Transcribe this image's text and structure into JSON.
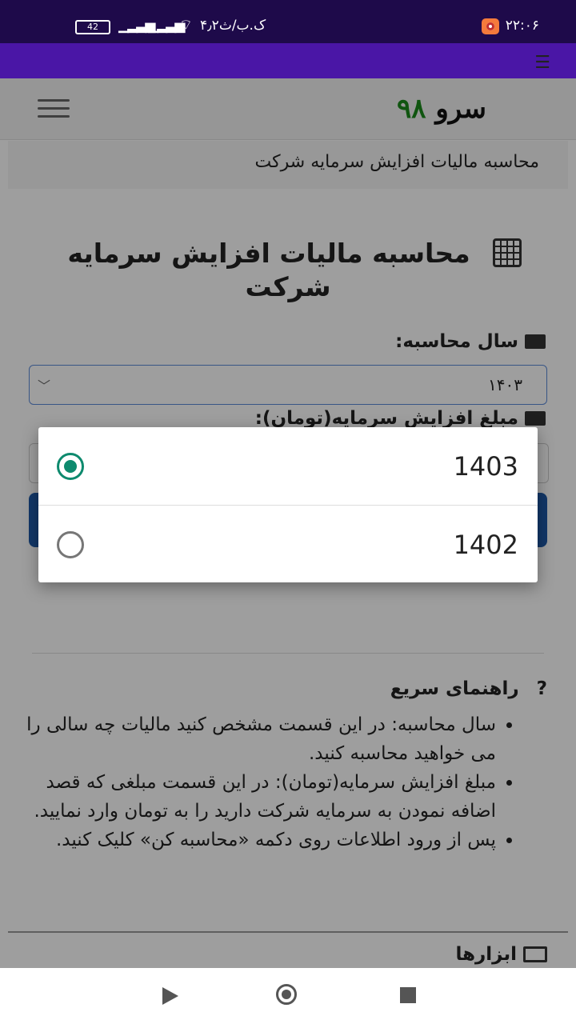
{
  "status_bar": {
    "time": "۲۲:۰۶",
    "network_speed": "۴٫۲ک.ب/ث",
    "battery": "42"
  },
  "header": {
    "logo_word": "سرو",
    "logo_number": "۹۸"
  },
  "breadcrumb": {
    "current": "محاسبه مالیات افزایش سرمایه شرکت"
  },
  "main": {
    "title": "محاسبه مالیات افزایش سرمایه شرکت",
    "year_label": "سال محاسبه:",
    "year_selected": "۱۴۰۳",
    "amount_label": "مبلغ افزایش سرمایه(تومان):"
  },
  "guide": {
    "title": "راهنمای سریع",
    "items": [
      "سال محاسبه: در این قسمت مشخص کنید مالیات چه سالی را می خواهید محاسبه کنید.",
      "مبلغ افزایش سرمایه(تومان): در این قسمت مبلغی که قصد اضافه نمودن به سرمایه شرکت دارید را به تومان وارد نمایید.",
      "پس از ورود اطلاعات روی دکمه «محاسبه کن» کلیک کنید."
    ]
  },
  "tools": {
    "title": "ابزارها"
  },
  "dialog": {
    "options": [
      {
        "label": "1403",
        "selected": true
      },
      {
        "label": "1402",
        "selected": false
      }
    ]
  },
  "colors": {
    "status_bar": "#1e0a4a",
    "app_bar": "#4a16a6",
    "radio_accent": "#0e8a6e",
    "button": "#1d5aa8"
  }
}
